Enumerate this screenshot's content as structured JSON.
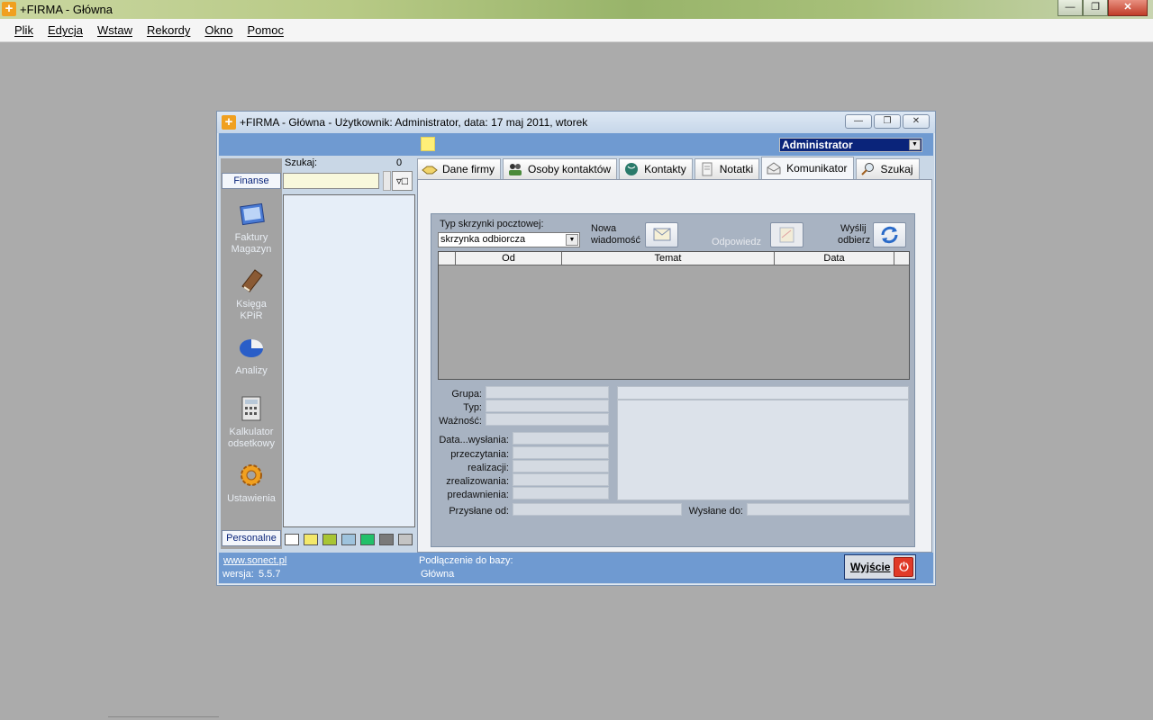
{
  "app": {
    "title": "+FIRMA - Główna"
  },
  "menu": [
    "Plik",
    "Edycja",
    "Wstaw",
    "Rekordy",
    "Okno",
    "Pomoc"
  ],
  "inner_window": {
    "title": "+FIRMA - Główna - Użytkownik:  Administrator, data: 17 maj 2011, wtorek",
    "user": "Administrator"
  },
  "nav": {
    "top_tab": "Finanse",
    "bottom_tab": "Personalne",
    "items": [
      {
        "line1": "Faktury",
        "line2": "Magazyn",
        "icon": "invoice-icon"
      },
      {
        "line1": "Księga",
        "line2": "KPiR",
        "icon": "book-icon"
      },
      {
        "line1": "Analizy",
        "line2": "",
        "icon": "pie-chart-icon"
      },
      {
        "line1": "Kalkulator",
        "line2": "odsetkowy",
        "icon": "calculator-icon"
      },
      {
        "line1": "Ustawienia",
        "line2": "",
        "icon": "gear-icon"
      }
    ]
  },
  "search": {
    "label": "Szukaj:",
    "count": "0",
    "filter_icon": "filter-icon",
    "swatch_colors": [
      "#ffffff",
      "#f3e86a",
      "#a8c534",
      "#9ec3dd",
      "#22c06a",
      "#7a7a7a",
      "#c4c4c4"
    ]
  },
  "tabs": [
    {
      "label": "Dane firmy",
      "icon": "handshake-icon",
      "active": false
    },
    {
      "label": "Osoby kontaktów",
      "icon": "people-icon",
      "active": false
    },
    {
      "label": "Kontakty",
      "icon": "globe-icon",
      "active": false
    },
    {
      "label": "Notatki",
      "icon": "note-icon",
      "active": false
    },
    {
      "label": "Komunikator",
      "icon": "envelope-icon",
      "active": true
    },
    {
      "label": "Szukaj",
      "icon": "magnifier-icon",
      "active": false
    }
  ],
  "komunikator": {
    "mailbox_type_label": "Typ skrzynki pocztowej:",
    "mailbox_type_value": "skrzynka odbiorcza",
    "new_message_label_1": "Nowa",
    "new_message_label_2": "wiadomość",
    "reply_label": "Odpowiedz",
    "send_receive_label_1": "Wyślij",
    "send_receive_label_2": "odbierz",
    "table_headers": [
      "",
      "Od",
      "Temat",
      "Data"
    ],
    "fields": {
      "group": "Grupa:",
      "type": "Typ:",
      "importance": "Ważność:",
      "date_sent": "Data...wysłania:",
      "read": "przeczytania:",
      "execution": "realizacji:",
      "executed": "zrealizowania:",
      "expiry": "predawnienia:",
      "sent_from": "Przysłane od:",
      "sent_to": "Wysłane do:"
    }
  },
  "status": {
    "website": "www.sonect.pl",
    "version_label": "wersja:",
    "version": "5.5.7",
    "db_label": "Podłączenie do bazy:",
    "db_value": "Główna",
    "exit_label": "Wyjście"
  }
}
